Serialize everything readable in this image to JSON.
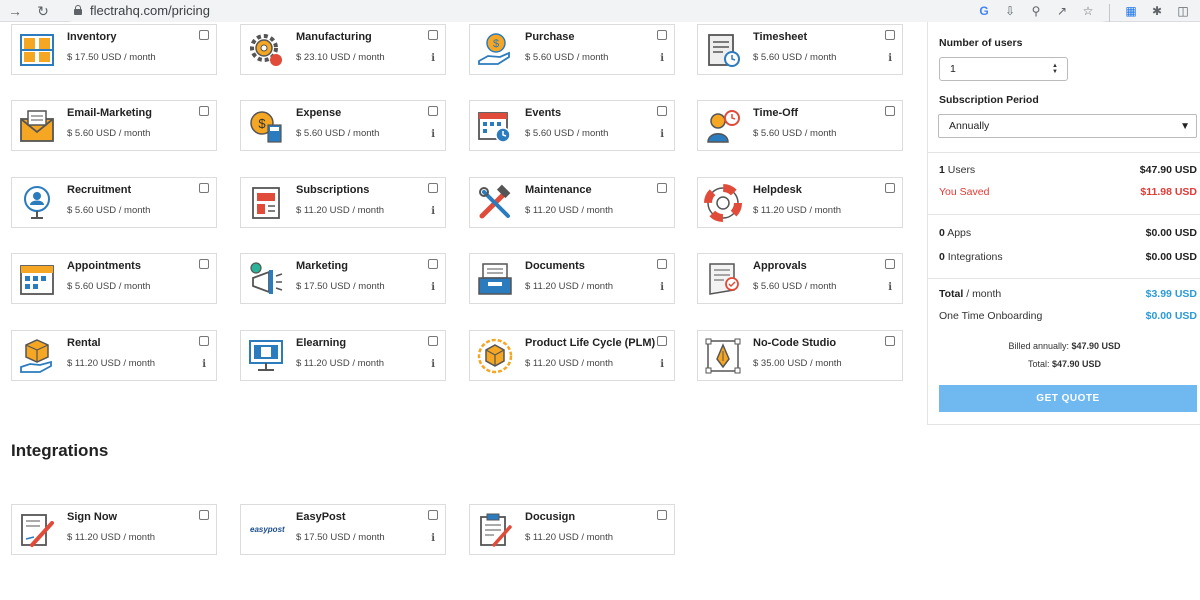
{
  "browser": {
    "url": "flectrahq.com/pricing",
    "icons": [
      "back-icon",
      "reload-icon",
      "google-icon",
      "download-icon",
      "zoom-icon",
      "share-icon",
      "star-icon",
      "translate-icon",
      "extensions-icon",
      "sidebar-icon"
    ]
  },
  "apps": [
    {
      "title": "Inventory",
      "price": "$ 17.50 USD / month",
      "info": false
    },
    {
      "title": "Manufacturing",
      "price": "$ 23.10 USD / month",
      "info": true
    },
    {
      "title": "Purchase",
      "price": "$ 5.60 USD / month",
      "info": true
    },
    {
      "title": "Timesheet",
      "price": "$ 5.60 USD / month",
      "info": true
    },
    {
      "title": "Email-Marketing",
      "price": "$ 5.60 USD / month",
      "info": false
    },
    {
      "title": "Expense",
      "price": "$ 5.60 USD / month",
      "info": true
    },
    {
      "title": "Events",
      "price": "$ 5.60 USD / month",
      "info": true
    },
    {
      "title": "Time-Off",
      "price": "$ 5.60 USD / month",
      "info": false
    },
    {
      "title": "Recruitment",
      "price": "$ 5.60 USD / month",
      "info": false
    },
    {
      "title": "Subscriptions",
      "price": "$ 11.20 USD / month",
      "info": true
    },
    {
      "title": "Maintenance",
      "price": "$ 11.20 USD / month",
      "info": false
    },
    {
      "title": "Helpdesk",
      "price": "$ 11.20 USD / month",
      "info": false
    },
    {
      "title": "Appointments",
      "price": "$ 5.60 USD / month",
      "info": false
    },
    {
      "title": "Marketing",
      "price": "$ 17.50 USD / month",
      "info": true
    },
    {
      "title": "Documents",
      "price": "$ 11.20 USD / month",
      "info": true
    },
    {
      "title": "Approvals",
      "price": "$ 5.60 USD / month",
      "info": true
    },
    {
      "title": "Rental",
      "price": "$ 11.20 USD / month",
      "info": true
    },
    {
      "title": "Elearning",
      "price": "$ 11.20 USD / month",
      "info": true
    },
    {
      "title": "Product Life Cycle (PLM)",
      "price": "$ 11.20 USD / month",
      "info": true
    },
    {
      "title": "No-Code Studio",
      "price": "$ 35.00 USD / month",
      "info": false
    }
  ],
  "integrations_title": "Integrations",
  "integrations": [
    {
      "title": "Sign Now",
      "price": "$ 11.20 USD / month",
      "info": false
    },
    {
      "title": "EasyPost",
      "price": "$ 17.50 USD / month",
      "info": true,
      "logo_text": "easypost"
    },
    {
      "title": "Docusign",
      "price": "$ 11.20 USD / month",
      "info": false
    }
  ],
  "info_glyph": "i",
  "panel": {
    "users_label": "Number of users",
    "users_value": "1",
    "period_label": "Subscription Period",
    "period_value": "Annually",
    "users_count": "1",
    "users_text": "Users",
    "users_total": "$47.90 USD",
    "saved_label": "You Saved",
    "saved_value": "$11.98 USD",
    "apps_count": "0",
    "apps_text": "Apps",
    "apps_total": "$0.00 USD",
    "integrations_count": "0",
    "integrations_text": "Integrations",
    "integrations_total": "$0.00 USD",
    "total_label": "Total",
    "total_suffix": " / month",
    "total_value": "$3.99 USD",
    "onboarding_label": "One Time Onboarding",
    "onboarding_value": "$0.00 USD",
    "billed_label": "Billed annually: ",
    "billed_value": "$47.90 USD",
    "total2_label": "Total: ",
    "total2_value": "$47.90 USD",
    "quote_button": "GET QUOTE"
  },
  "colors": {
    "accent": "#2b9bd8",
    "danger": "#e53935",
    "button": "#6fb8f0",
    "icon_orange": "#f5a623",
    "icon_blue": "#2b7bbf",
    "icon_red": "#e04b3a"
  }
}
